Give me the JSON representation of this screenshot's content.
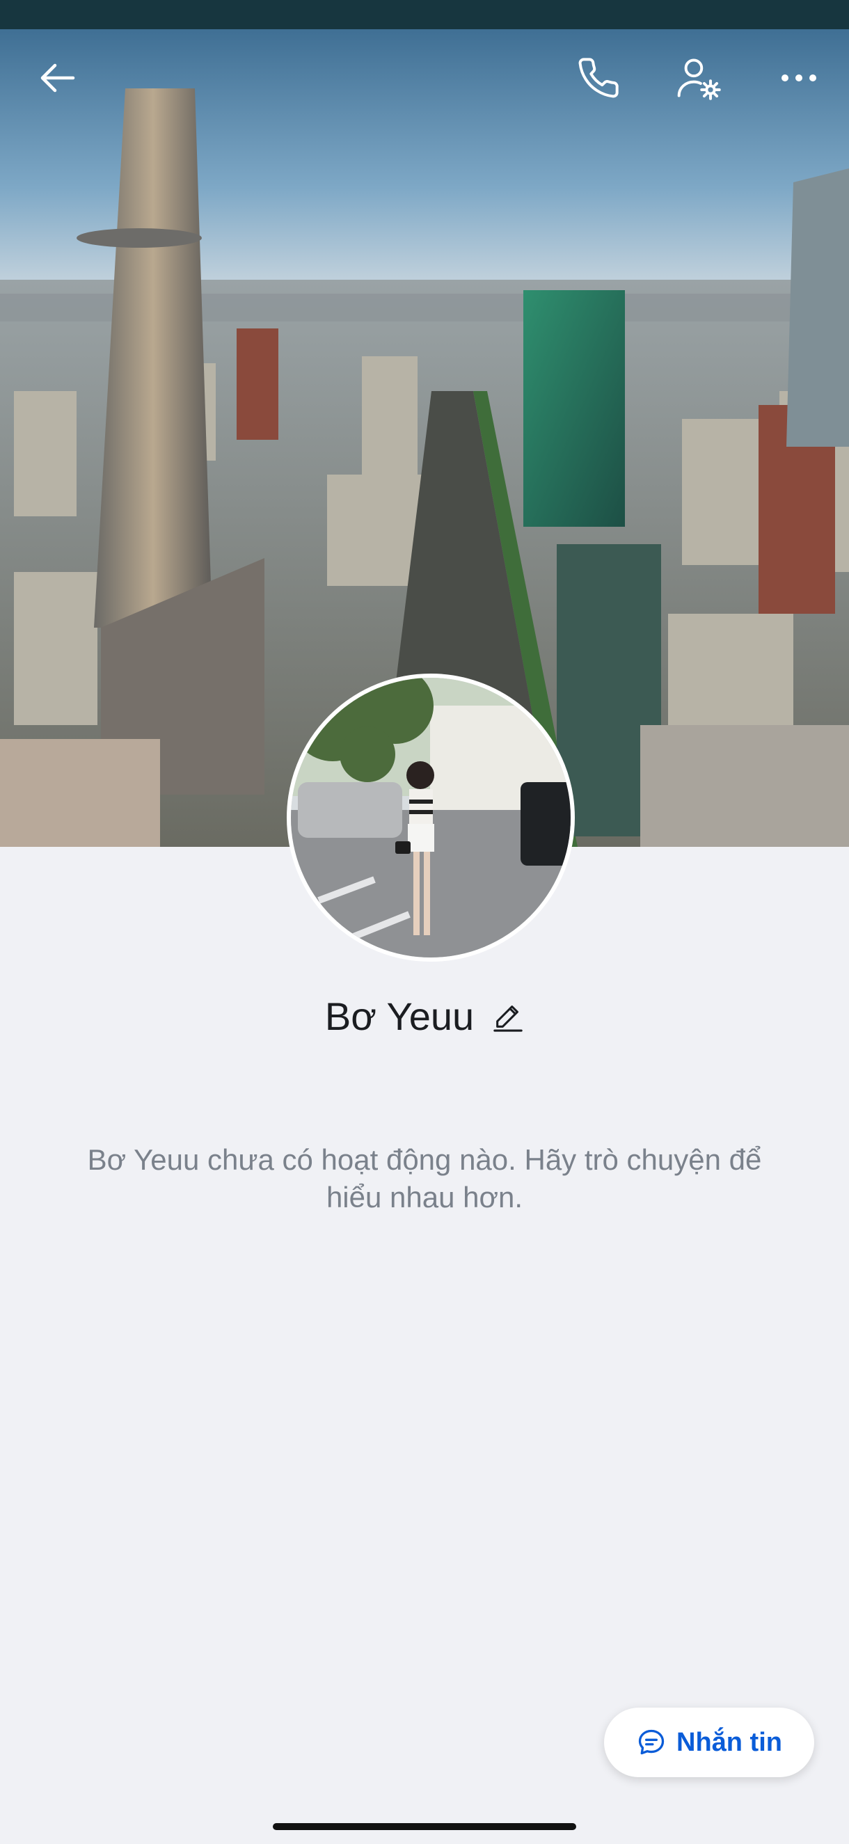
{
  "header": {
    "back_icon": "arrow-left-icon",
    "call_icon": "phone-icon",
    "settings_icon": "user-settings-icon",
    "more_icon": "more-horizontal-icon"
  },
  "cover": {
    "image": "city-skyline-cover-photo"
  },
  "profile": {
    "avatar_image": "avatar-photo",
    "name": "Bơ Yeuu",
    "edit_icon": "pencil-icon"
  },
  "feed": {
    "empty_message": "Bơ Yeuu chưa có hoạt động nào. Hãy trò chuyện để hiểu nhau hơn."
  },
  "actions": {
    "message_label": "Nhắn tin",
    "message_icon": "chat-bubble-icon"
  },
  "colors": {
    "accent": "#0a5cd8",
    "background": "#f0f1f5",
    "status_bar": "#17363f"
  }
}
